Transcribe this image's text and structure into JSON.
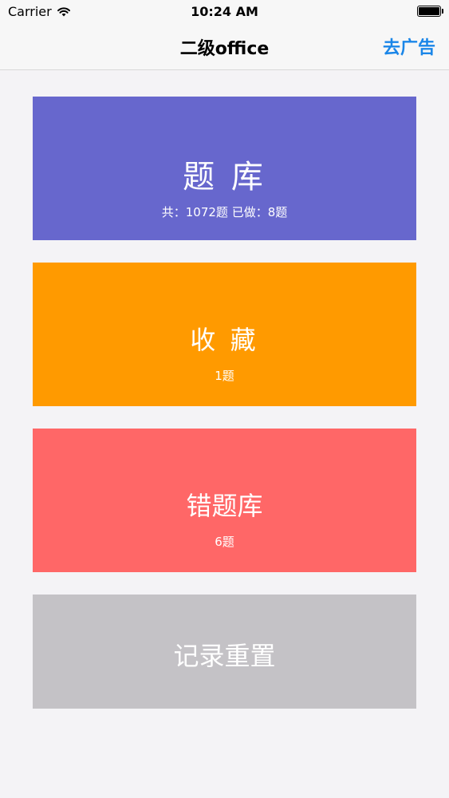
{
  "status_bar": {
    "carrier": "Carrier",
    "time": "10:24 AM"
  },
  "nav": {
    "title": "二级office",
    "action": "去广告"
  },
  "cards": [
    {
      "title": "题 库",
      "subtitle": "共：1072题  已做：8题"
    },
    {
      "title": "收 藏",
      "subtitle": "1题"
    },
    {
      "title": "错题库",
      "subtitle": "6题"
    },
    {
      "title": "记录重置"
    }
  ],
  "colors": {
    "question_bank": "#6767cd",
    "favorites": "#ff9a00",
    "wrong_questions": "#ff6767",
    "reset": "#c4c2c6",
    "nav_action": "#1a86e8"
  },
  "icons": {
    "wifi": "wifi-icon",
    "battery": "battery-icon"
  }
}
